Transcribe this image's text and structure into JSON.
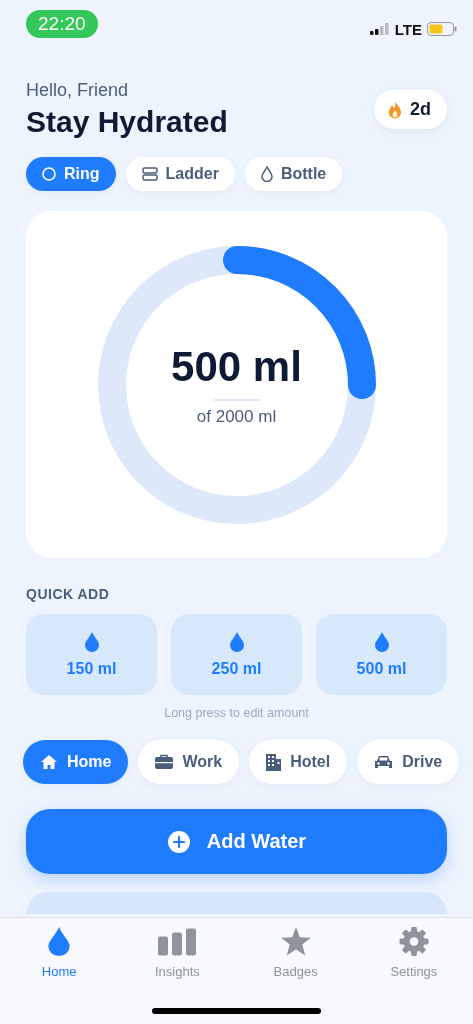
{
  "status_bar": {
    "time": "22:20",
    "network": "LTE"
  },
  "header": {
    "greeting": "Hello, Friend",
    "title": "Stay Hydrated",
    "streak": "2d"
  },
  "view_modes": [
    {
      "label": "Ring",
      "selected": true
    },
    {
      "label": "Ladder",
      "selected": false
    },
    {
      "label": "Bottle",
      "selected": false
    }
  ],
  "progress": {
    "amount": "500 ml",
    "goal": "of 2000 ml",
    "level": 0.25
  },
  "quick_add": {
    "title": "QUICK ADD",
    "hint": "Long press to edit amount",
    "amounts": [
      {
        "label": "150 ml"
      },
      {
        "label": "250 ml"
      },
      {
        "label": "500 ml"
      }
    ]
  },
  "locations": [
    {
      "label": "Home",
      "selected": true
    },
    {
      "label": "Work",
      "selected": false
    },
    {
      "label": "Hotel",
      "selected": false
    },
    {
      "label": "Drive",
      "selected": false
    }
  ],
  "add_button": {
    "label": "Add Water"
  },
  "tab_bar": [
    {
      "label": "Home",
      "selected": true
    },
    {
      "label": "Insights",
      "selected": false
    },
    {
      "label": "Badges",
      "selected": false
    },
    {
      "label": "Settings",
      "selected": false
    }
  ]
}
